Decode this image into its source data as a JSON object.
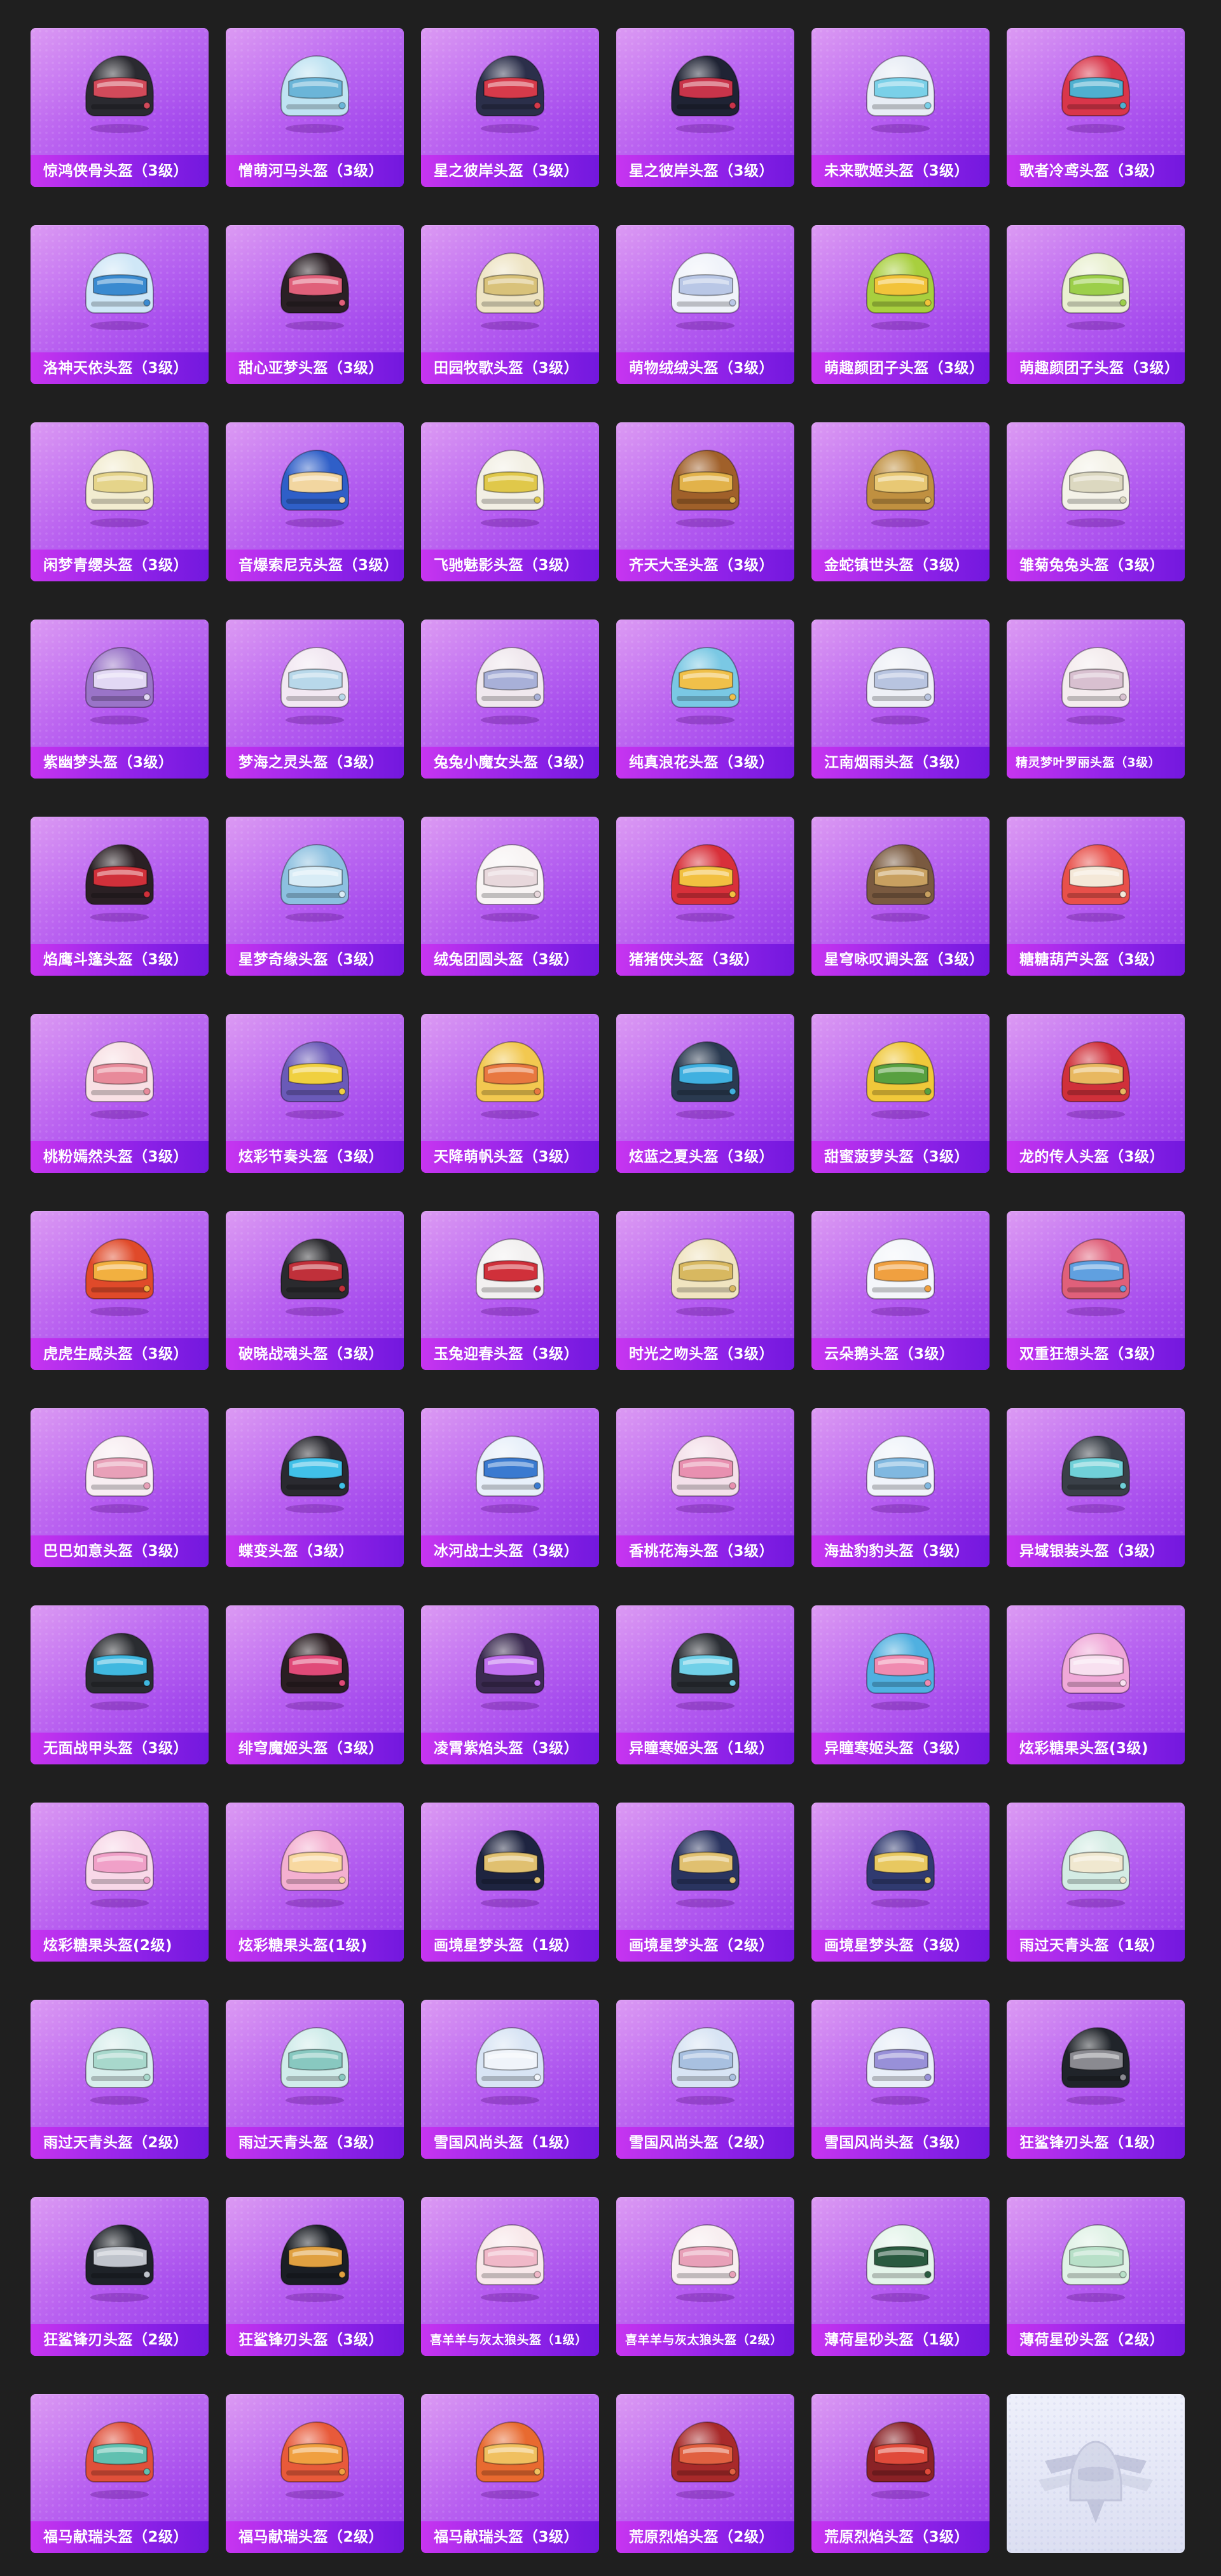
{
  "colors": {
    "page_background": "#1f1f1f",
    "card_gradient_start": "#d88ff2",
    "card_gradient_end": "#9338ea",
    "caption_gradient_start": "#c735f0",
    "caption_gradient_end": "#7318de",
    "placeholder_background": "#e6e8f7"
  },
  "grid": {
    "columns": 6
  },
  "items": [
    {
      "name": "惊鸿侠骨头盔（3级）",
      "icon": "level-3-helmet-black-icon",
      "color": "#2a2a30",
      "accent": "#d14a5a"
    },
    {
      "name": "憎萌河马头盔（3级）",
      "icon": "hippo-helmet-icon",
      "color": "#bfe3f2",
      "accent": "#6bb5d8"
    },
    {
      "name": "星之彼岸头盔（3级）",
      "icon": "starry-helmet-icon",
      "color": "#2b2f4a",
      "accent": "#d63a4a"
    },
    {
      "name": "星之彼岸头盔（3级）",
      "icon": "starry-helmet-icon",
      "color": "#1f2334",
      "accent": "#c8344a"
    },
    {
      "name": "未来歌姬头盔（3级）",
      "icon": "future-diva-helmet-icon",
      "color": "#e8edf5",
      "accent": "#7ad0e8"
    },
    {
      "name": "歌者冷鸢头盔（3级）",
      "icon": "singer-helmet-icon",
      "color": "#d9364a",
      "accent": "#4fb0d0"
    },
    {
      "name": "洛神天依头盔（3级）",
      "icon": "tianyi-helmet-icon",
      "color": "#cfe7f7",
      "accent": "#3a8ad0"
    },
    {
      "name": "甜心亚梦头盔（3级）",
      "icon": "sweetheart-helmet-icon",
      "color": "#2a2025",
      "accent": "#e0607a"
    },
    {
      "name": "田园牧歌头盔（3级）",
      "icon": "pastoral-helmet-icon",
      "color": "#eee4c4",
      "accent": "#d9c27a"
    },
    {
      "name": "萌物绒绒头盔（3级）",
      "icon": "fluffy-helmet-icon",
      "color": "#f0f3fa",
      "accent": "#b9c7e6"
    },
    {
      "name": "萌趣颜团子头盔（3级）",
      "icon": "dango-helmet-icon",
      "color": "#a8cf3e",
      "accent": "#f2c33a"
    },
    {
      "name": "萌趣颜团子头盔（3级）",
      "icon": "dango-helmet-icon",
      "color": "#e9f0d0",
      "accent": "#9ccf4a"
    },
    {
      "name": "闲梦青缨头盔（3级）",
      "icon": "tassel-helmet-icon",
      "color": "#f2ecd0",
      "accent": "#e5d48a"
    },
    {
      "name": "音爆索尼克头盔（3级）",
      "icon": "sonic-helmet-icon",
      "color": "#2f5fc8",
      "accent": "#f2d6a0"
    },
    {
      "name": "飞驰魅影头盔（3级）",
      "icon": "phantom-helmet-icon",
      "color": "#f2efe4",
      "accent": "#e0c84a"
    },
    {
      "name": "齐天大圣头盔（3级）",
      "icon": "monkey-king-helmet-icon",
      "color": "#a0602a",
      "accent": "#e2b24a"
    },
    {
      "name": "金蛇镇世头盔（3级）",
      "icon": "golden-snake-helmet-icon",
      "color": "#c09040",
      "accent": "#e8c874"
    },
    {
      "name": "雏菊兔兔头盔（3级）",
      "icon": "bunny-helmet-icon",
      "color": "#f4f2e8",
      "accent": "#dcd8c0"
    },
    {
      "name": "紫幽梦头盔（3级）",
      "icon": "purple-dream-helmet-icon",
      "color": "#9a74c8",
      "accent": "#e2d8f4"
    },
    {
      "name": "梦海之灵头盔（3级）",
      "icon": "dream-sea-helmet-icon",
      "color": "#f2e8f2",
      "accent": "#b8d8ea"
    },
    {
      "name": "兔兔小魔女头盔（3级）",
      "icon": "bunny-witch-helmet-icon",
      "color": "#f0e8ee",
      "accent": "#a8b0d8"
    },
    {
      "name": "纯真浪花头盔（3级）",
      "icon": "wave-helmet-icon",
      "color": "#7ac8e4",
      "accent": "#f0c04a"
    },
    {
      "name": "江南烟雨头盔（3级）",
      "icon": "misty-rain-helmet-icon",
      "color": "#eef0f6",
      "accent": "#b8c4e0"
    },
    {
      "name": "精灵梦叶罗丽头盔（3级）",
      "icon": "elf-dream-helmet-icon",
      "color": "#f4ecee",
      "accent": "#d8c0d0"
    },
    {
      "name": "焰鹰斗篷头盔（3级）",
      "icon": "flame-eagle-helmet-icon",
      "color": "#2a2024",
      "accent": "#d0303a"
    },
    {
      "name": "星梦奇缘头盔（3级）",
      "icon": "star-dream-helmet-icon",
      "color": "#8cc0e0",
      "accent": "#d8ecf6"
    },
    {
      "name": "绒兔团圆头盔（3级）",
      "icon": "plush-bunny-helmet-icon",
      "color": "#f8f4f4",
      "accent": "#e8d8dc"
    },
    {
      "name": "猪猪侠头盔（3级）",
      "icon": "gg-bond-helmet-icon",
      "color": "#d8303a",
      "accent": "#f2c040"
    },
    {
      "name": "星穹咏叹调头盔（3级）",
      "icon": "starry-aria-helmet-icon",
      "color": "#7a5a40",
      "accent": "#c8a060"
    },
    {
      "name": "糖糖葫芦头盔（3级）",
      "icon": "candied-haws-helmet-icon",
      "color": "#e8504a",
      "accent": "#f4e8d8"
    },
    {
      "name": "桃粉嫣然头盔（3级）",
      "icon": "peach-pink-helmet-icon",
      "color": "#f8e0e4",
      "accent": "#e88a9a"
    },
    {
      "name": "炫彩节奏头盔（3级）",
      "icon": "rhythm-helmet-icon",
      "color": "#6a5ab8",
      "accent": "#f0d040"
    },
    {
      "name": "天降萌帆头盔（3级）",
      "icon": "sail-helmet-icon",
      "color": "#f2c850",
      "accent": "#e87840"
    },
    {
      "name": "炫蓝之夏头盔（3级）",
      "icon": "blue-summer-helmet-icon",
      "color": "#2a3a50",
      "accent": "#40b0e0"
    },
    {
      "name": "甜蜜菠萝头盔（3级）",
      "icon": "pineapple-helmet-icon",
      "color": "#f0c83a",
      "accent": "#58a040"
    },
    {
      "name": "龙的传人头盔（3级）",
      "icon": "dragon-heir-helmet-icon",
      "color": "#d0303a",
      "accent": "#e8b860"
    },
    {
      "name": "虎虎生威头盔（3级）",
      "icon": "tiger-helmet-icon",
      "color": "#e04a2a",
      "accent": "#f2b040"
    },
    {
      "name": "破晓战魂头盔（3级）",
      "icon": "dawn-spirit-helmet-icon",
      "color": "#2a2a2e",
      "accent": "#c0303a"
    },
    {
      "name": "玉兔迎春头盔（3级）",
      "icon": "jade-rabbit-helmet-icon",
      "color": "#f2f0f0",
      "accent": "#d0303a"
    },
    {
      "name": "时光之吻头盔（3级）",
      "icon": "time-kiss-helmet-icon",
      "color": "#f0e4c0",
      "accent": "#d8b860"
    },
    {
      "name": "云朵鹅头盔（3级）",
      "icon": "cloud-goose-helmet-icon",
      "color": "#f4f6fa",
      "accent": "#f0a040"
    },
    {
      "name": "双重狂想头盔（3级）",
      "icon": "double-fantasy-helmet-icon",
      "color": "#e0607a",
      "accent": "#60a0e0"
    },
    {
      "name": "巴巴如意头盔（3级）",
      "icon": "ruyi-helmet-icon",
      "color": "#f8eef2",
      "accent": "#e8a0b8"
    },
    {
      "name": "蝶变头盔（3级）",
      "icon": "butterfly-helmet-icon",
      "color": "#2a2a30",
      "accent": "#40c0e8"
    },
    {
      "name": "冰河战士头盔（3级）",
      "icon": "glacier-warrior-helmet-icon",
      "color": "#e8f0fa",
      "accent": "#3a7ad0"
    },
    {
      "name": "香桃花海头盔（3级）",
      "icon": "peach-blossom-helmet-icon",
      "color": "#f4e0ea",
      "accent": "#e890b0"
    },
    {
      "name": "海盐豹豹头盔（3级）",
      "icon": "sea-salt-leopard-helmet-icon",
      "color": "#f0f4fa",
      "accent": "#80b8e0"
    },
    {
      "name": "异域银装头盔（3级）",
      "icon": "exotic-silver-helmet-icon",
      "color": "#3a4048",
      "accent": "#70d0d8"
    },
    {
      "name": "无面战甲头盔（3级）",
      "icon": "faceless-armor-helmet-icon",
      "color": "#2a2c30",
      "accent": "#40b8e0"
    },
    {
      "name": "绯穹魔姬头盔（3级）",
      "icon": "crimson-witch-helmet-icon",
      "color": "#2a1e22",
      "accent": "#e04a78"
    },
    {
      "name": "凌霄紫焰头盔（3级）",
      "icon": "purple-flame-helmet-icon",
      "color": "#3a2a50",
      "accent": "#c070f0"
    },
    {
      "name": "异瞳寒姬头盔（1级）",
      "icon": "odd-eye-helmet-icon",
      "color": "#2a2e34",
      "accent": "#70d0e8"
    },
    {
      "name": "异瞳寒姬头盔（3级）",
      "icon": "odd-eye-helmet-icon",
      "color": "#50b0e0",
      "accent": "#f08ab0"
    },
    {
      "name": "炫彩糖果头盔(3级)",
      "icon": "candy-helmet-icon",
      "color": "#f0a8d8",
      "accent": "#f8e0f0"
    },
    {
      "name": "炫彩糖果头盔(2级)",
      "icon": "candy-helmet-icon",
      "color": "#f8d8e8",
      "accent": "#f0a0c8"
    },
    {
      "name": "炫彩糖果头盔(1级)",
      "icon": "candy-helmet-icon",
      "color": "#f4b0d0",
      "accent": "#f8d8a0"
    },
    {
      "name": "画境星梦头盔（1级）",
      "icon": "painted-star-helmet-icon",
      "color": "#1e2440",
      "accent": "#e0c070"
    },
    {
      "name": "画境星梦头盔（2级）",
      "icon": "painted-star-helmet-icon",
      "color": "#2a3460",
      "accent": "#e0c070"
    },
    {
      "name": "画境星梦头盔（3级）",
      "icon": "painted-star-helmet-icon",
      "color": "#303a70",
      "accent": "#e8c860"
    },
    {
      "name": "雨过天青头盔（1级）",
      "icon": "celadon-helmet-icon",
      "color": "#d4ece4",
      "accent": "#f0e8d0"
    },
    {
      "name": "雨过天青头盔（2级）",
      "icon": "celadon-helmet-icon",
      "color": "#d8eeec",
      "accent": "#a8d8cc"
    },
    {
      "name": "雨过天青头盔（3级）",
      "icon": "celadon-helmet-icon",
      "color": "#d0ecea",
      "accent": "#88c8c0"
    },
    {
      "name": "雪国风尚头盔（1级）",
      "icon": "snow-country-helmet-icon",
      "color": "#d8e4f4",
      "accent": "#f0f4fa"
    },
    {
      "name": "雪国风尚头盔（2级）",
      "icon": "snow-country-helmet-icon",
      "color": "#d8e4f4",
      "accent": "#a8c0e0"
    },
    {
      "name": "雪国风尚头盔（3级）",
      "icon": "snow-country-helmet-icon",
      "color": "#e8eef8",
      "accent": "#9890d8"
    },
    {
      "name": "狂鲨锋刃头盔（1级）",
      "icon": "shark-blade-helmet-icon",
      "color": "#20242a",
      "accent": "#8a8a90"
    },
    {
      "name": "狂鲨锋刃头盔（2级）",
      "icon": "shark-blade-helmet-icon",
      "color": "#1e2228",
      "accent": "#c0c4cc"
    },
    {
      "name": "狂鲨锋刃头盔（3级）",
      "icon": "shark-blade-helmet-icon",
      "color": "#1a1e24",
      "accent": "#e0a040"
    },
    {
      "name": "喜羊羊与灰太狼头盔（1级）",
      "icon": "pleasant-goat-helmet-icon",
      "color": "#f8e8ea",
      "accent": "#f0b8c8"
    },
    {
      "name": "喜羊羊与灰太狼头盔（2级）",
      "icon": "pleasant-goat-helmet-icon",
      "color": "#f8eef0",
      "accent": "#e8a0b8"
    },
    {
      "name": "薄荷星砂头盔（1级）",
      "icon": "mint-sand-helmet-icon",
      "color": "#e4f4ea",
      "accent": "#2a5a40"
    },
    {
      "name": "薄荷星砂头盔（2级）",
      "icon": "mint-sand-helmet-icon",
      "color": "#e0f2e6",
      "accent": "#b8e0c8"
    },
    {
      "name": "福马献瑞头盔（2级）",
      "icon": "lucky-horse-helmet-icon",
      "color": "#e0503a",
      "accent": "#60c0b0"
    },
    {
      "name": "福马献瑞头盔（2级）",
      "icon": "lucky-horse-helmet-icon",
      "color": "#e85a3a",
      "accent": "#f0a040"
    },
    {
      "name": "福马献瑞头盔（3级）",
      "icon": "lucky-horse-helmet-icon",
      "color": "#e86a30",
      "accent": "#f0c060"
    },
    {
      "name": "荒原烈焰头盔（2级）",
      "icon": "wasteland-flame-helmet-icon",
      "color": "#a82a2a",
      "accent": "#e06040"
    },
    {
      "name": "荒原烈焰头盔（3级）",
      "icon": "wasteland-flame-helmet-icon",
      "color": "#8a2226",
      "accent": "#e04a3a"
    },
    {
      "name": "",
      "icon": "placeholder-emblem-icon",
      "color": "#c8cce0",
      "accent": "#a8acc8",
      "placeholder": true
    }
  ]
}
